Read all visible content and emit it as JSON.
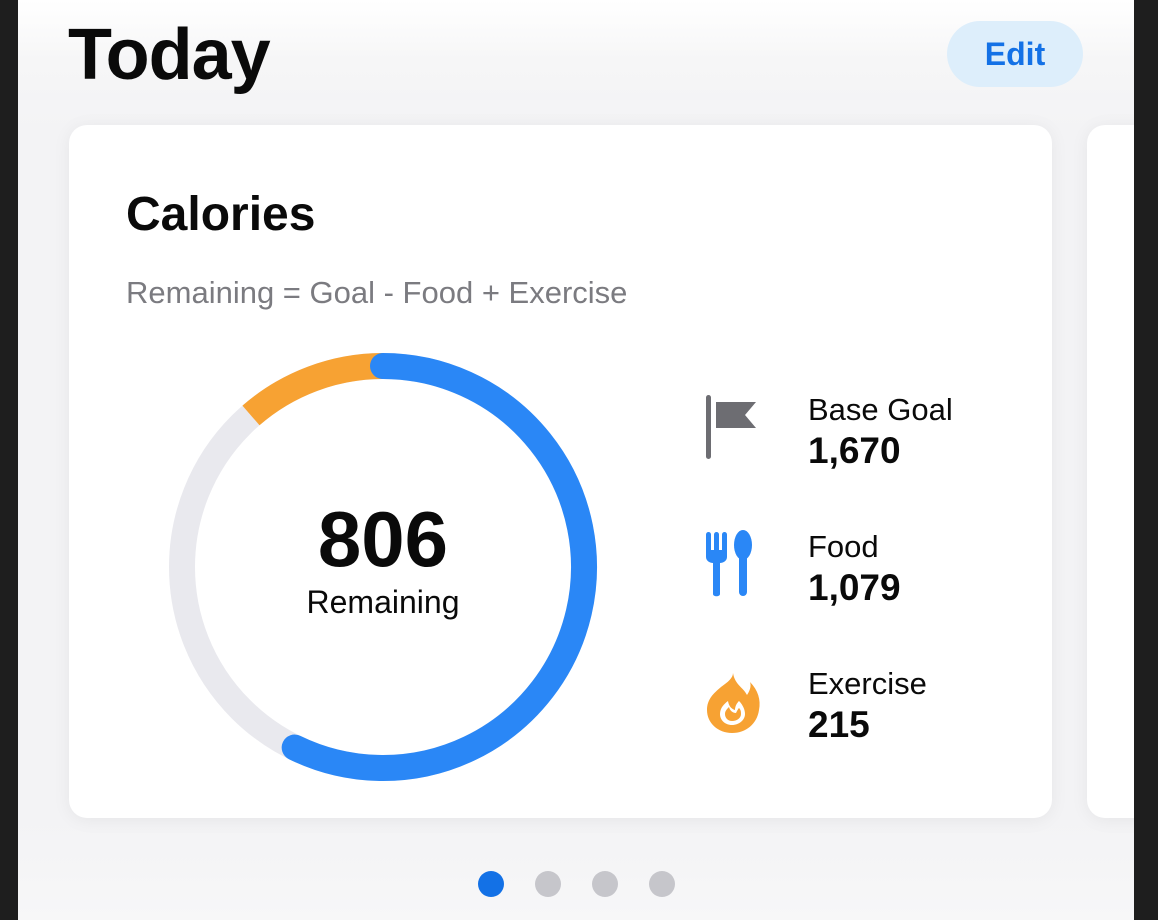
{
  "header": {
    "title": "Today",
    "edit_label": "Edit"
  },
  "calories_card": {
    "title": "Calories",
    "formula": "Remaining = Goal - Food + Exercise",
    "remaining": {
      "value": "806",
      "label": "Remaining"
    },
    "ring": {
      "goal_total": 1885,
      "food": 1079,
      "exercise": 215,
      "colors": {
        "food": "#2a87f6",
        "exercise": "#f7a233",
        "track": "#e9e9ee"
      }
    },
    "stats": [
      {
        "icon": "flag-icon",
        "label": "Base Goal",
        "value": "1,670",
        "color": "#6d6d72"
      },
      {
        "icon": "fork-spoon-icon",
        "label": "Food",
        "value": "1,079",
        "color": "#2a87f6"
      },
      {
        "icon": "flame-icon",
        "label": "Exercise",
        "value": "215",
        "color": "#f7a233"
      }
    ]
  },
  "pager": {
    "pages": 4,
    "active_index": 0,
    "active_color": "#1371e6",
    "inactive_color": "#c6c6cb"
  }
}
